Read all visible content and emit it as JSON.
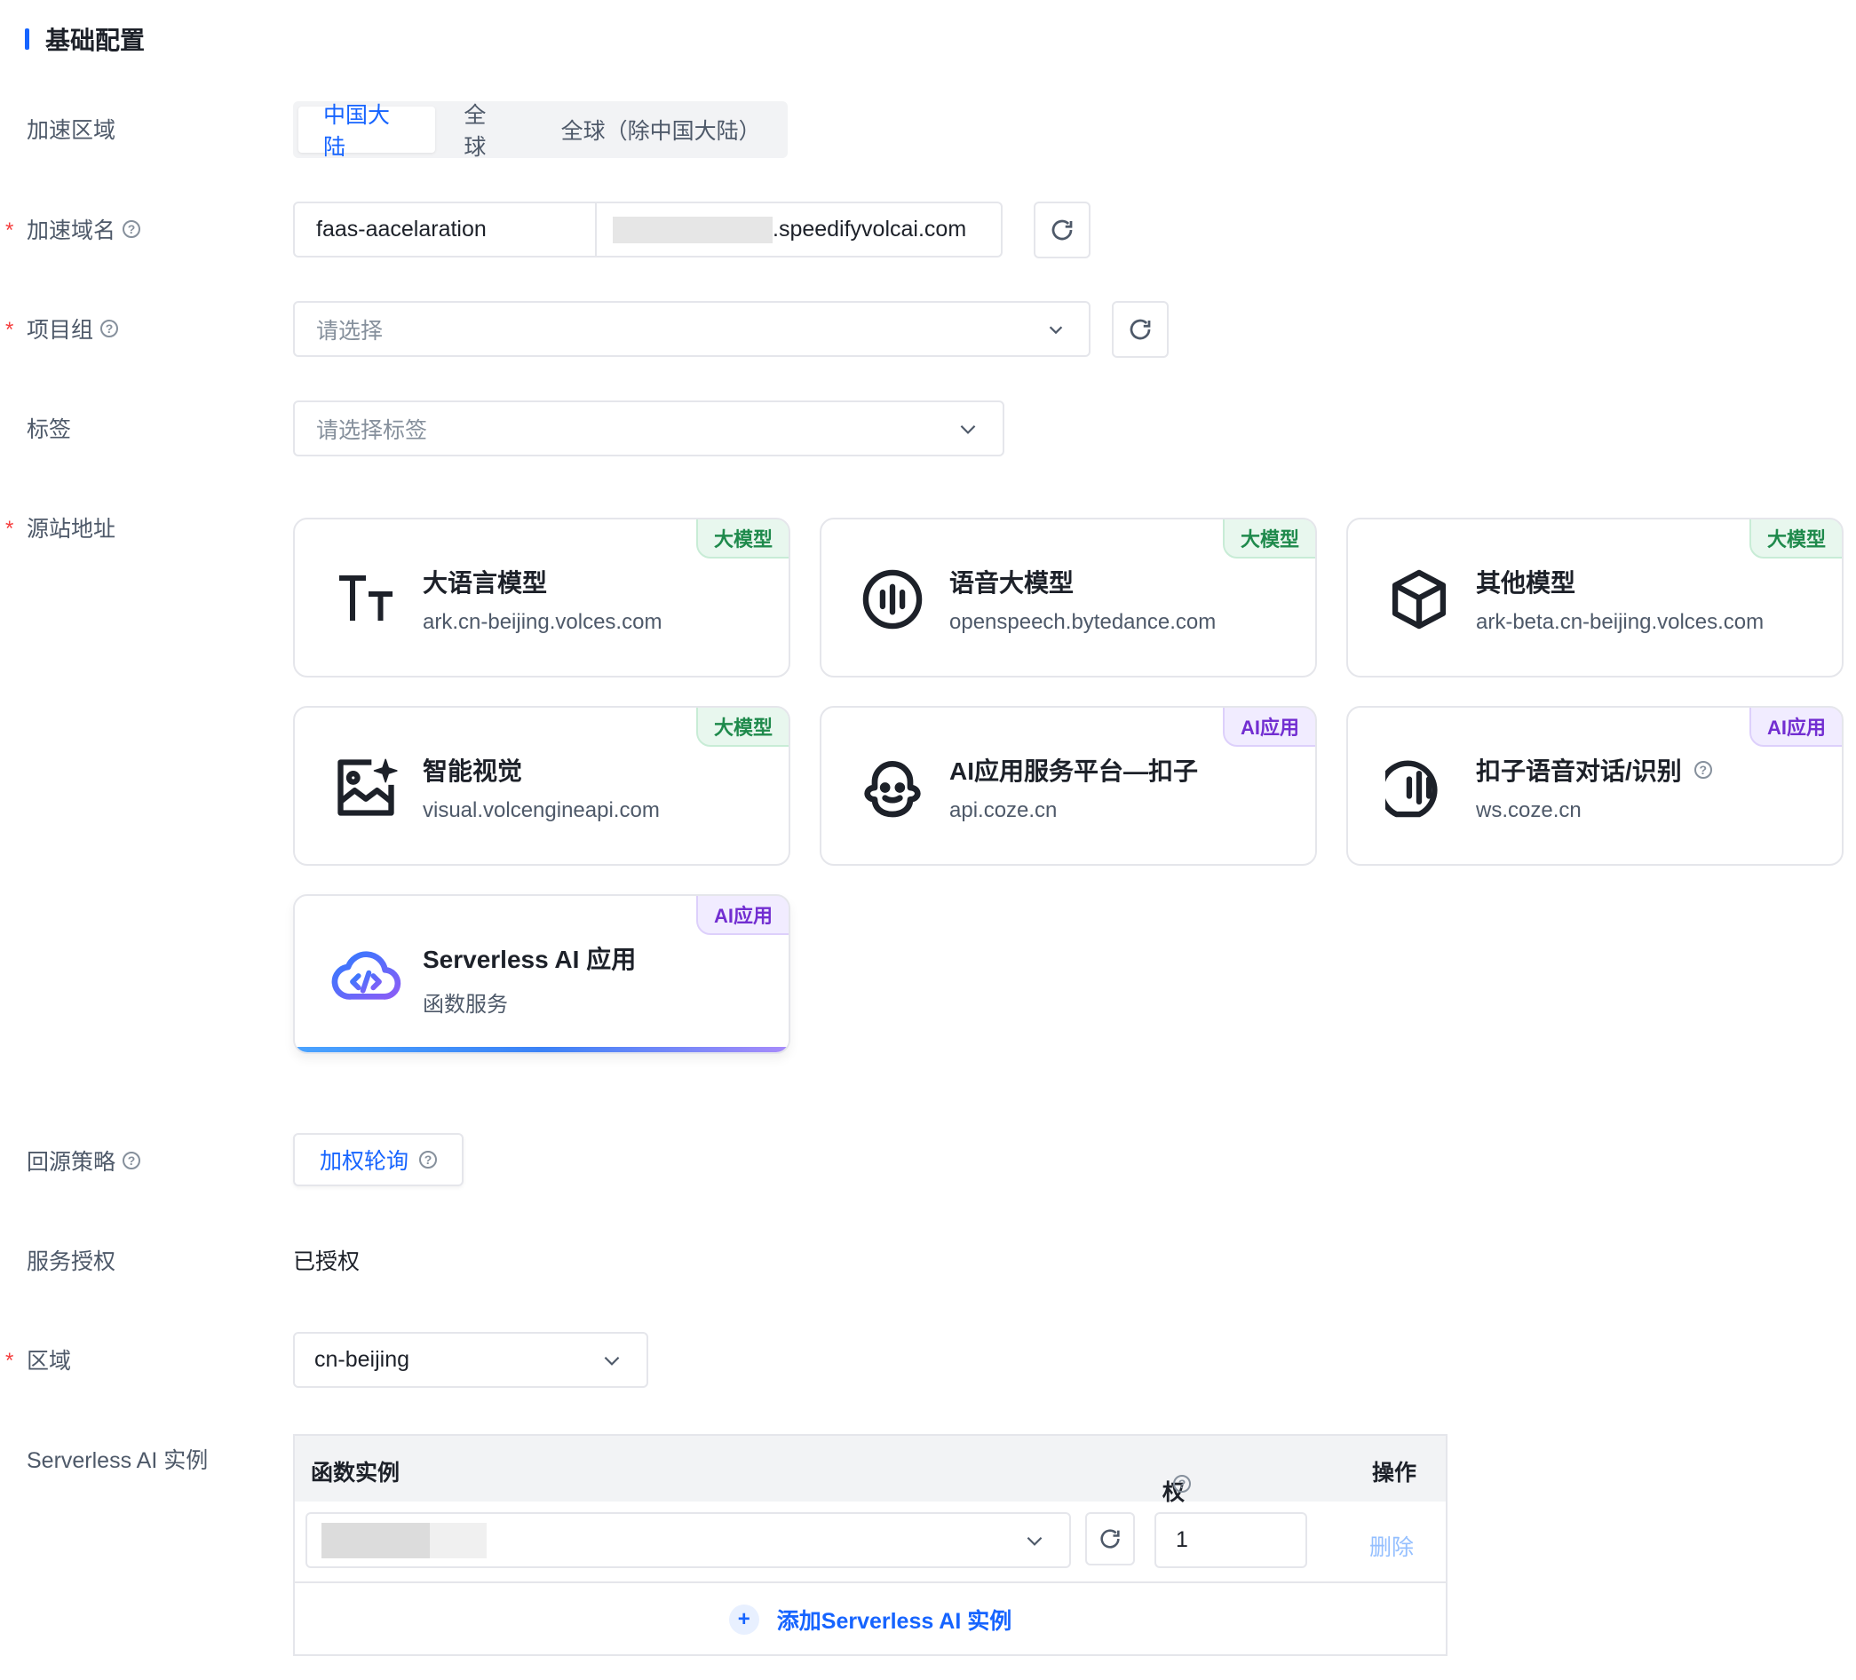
{
  "section": {
    "title": "基础配置"
  },
  "labels": {
    "region": "加速区域",
    "domain": "加速域名",
    "project": "项目组",
    "tags": "标签",
    "origin": "源站地址",
    "strategy": "回源策略",
    "auth": "服务授权",
    "area": "区域",
    "instance": "Serverless AI 实例"
  },
  "region_options": [
    "中国大陆",
    "全球",
    "全球（除中国大陆）"
  ],
  "domain": {
    "prefix": "faas-aacelaration",
    "suffix": ".speedifyvolcai.com"
  },
  "project": {
    "placeholder": "请选择"
  },
  "tags": {
    "placeholder": "请选择标签"
  },
  "cards": [
    {
      "title": "大语言模型",
      "sub": "ark.cn-beijing.volces.com",
      "badge": "大模型",
      "icon": "text-size-icon"
    },
    {
      "title": "语音大模型",
      "sub": "openspeech.bytedance.com",
      "badge": "大模型",
      "icon": "voice-wave-icon"
    },
    {
      "title": "其他模型",
      "sub": "ark-beta.cn-beijing.volces.com",
      "badge": "大模型",
      "icon": "cube-icon"
    },
    {
      "title": "智能视觉",
      "sub": "visual.volcengineapi.com",
      "badge": "大模型",
      "icon": "image-sparkle-icon"
    },
    {
      "title": "AI应用服务平台—扣子",
      "sub": "api.coze.cn",
      "badge": "AI应用",
      "icon": "coze-icon"
    },
    {
      "title": "扣子语音对话/识别",
      "sub": "ws.coze.cn",
      "badge": "AI应用",
      "icon": "voice-chat-icon"
    },
    {
      "title": "Serverless AI 应用",
      "sub": "函数服务",
      "badge": "AI应用",
      "icon": "cloud-code-icon"
    }
  ],
  "strategy": {
    "value": "加权轮询"
  },
  "auth": {
    "value": "已授权"
  },
  "area": {
    "value": "cn-beijing"
  },
  "table": {
    "headers": [
      "函数实例",
      "权重",
      "操作"
    ],
    "row": {
      "weight": "1",
      "action": "删除"
    },
    "add_label": "添加Serverless AI 实例"
  },
  "colors": {
    "primary": "#1664ff",
    "required": "#f53f3f",
    "badge_green": "#1f8a4c",
    "badge_purple": "#722ed1"
  }
}
